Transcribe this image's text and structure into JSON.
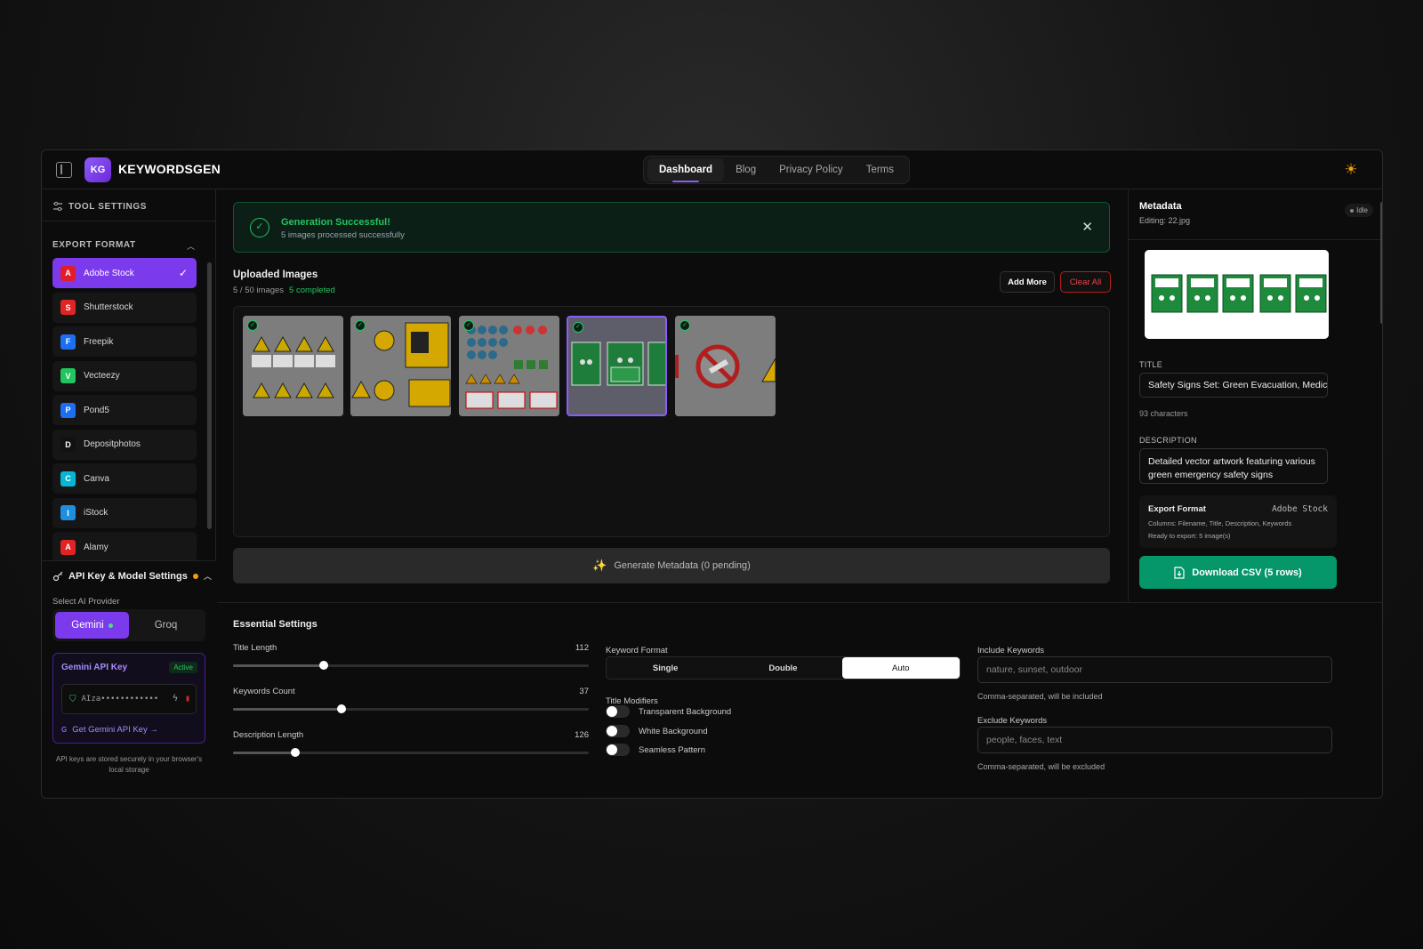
{
  "app": {
    "logo_badge": "KG",
    "name": "KEYWORDSGEN"
  },
  "nav": [
    {
      "label": "Dashboard",
      "active": true
    },
    {
      "label": "Blog"
    },
    {
      "label": "Privacy Policy"
    },
    {
      "label": "Terms"
    }
  ],
  "sidebar": {
    "tool_settings": "TOOL SETTINGS",
    "export_format": "EXPORT FORMAT",
    "platforms": [
      {
        "letter": "A",
        "label": "Adobe Stock",
        "color": "#e11d2d",
        "selected": true
      },
      {
        "letter": "S",
        "label": "Shutterstock",
        "color": "#e02424"
      },
      {
        "letter": "F",
        "label": "Freepik",
        "color": "#1d6ff2"
      },
      {
        "letter": "V",
        "label": "Vecteezy",
        "color": "#22c55e"
      },
      {
        "letter": "P",
        "label": "Pond5",
        "color": "#1d6ff2"
      },
      {
        "letter": "D",
        "label": "Depositphotos",
        "color": "#111111"
      },
      {
        "letter": "C",
        "label": "Canva",
        "color": "#06b6d4"
      },
      {
        "letter": "I",
        "label": "iStock",
        "color": "#1d8fe0"
      },
      {
        "letter": "A",
        "label": "Alamy",
        "color": "#e02424"
      }
    ],
    "api_title": "API Key & Model Settings",
    "provider_label": "Select AI Provider",
    "providers": [
      "Gemini",
      "Groq"
    ],
    "key_title": "Gemini API Key",
    "key_status": "Active",
    "key_value": "AIza••••••••••••",
    "get_key": "Get Gemini API Key →",
    "get_key_badge": "G",
    "storage_note": "API keys are stored securely in your browser's local storage"
  },
  "alert": {
    "title": "Generation Successful!",
    "message": "5 images processed successfully"
  },
  "uploads": {
    "title": "Uploaded Images",
    "count": "5 / 50 images",
    "completed": "5 completed",
    "add_more": "Add More",
    "clear_all": "Clear All",
    "generate": "Generate Metadata (0 pending)"
  },
  "metadata": {
    "title": "Metadata",
    "editing": "Editing: 22.jpg",
    "status": "Idle",
    "title_label": "TITLE",
    "title_value": "Safety Signs Set: Green Evacuation, Medical",
    "title_chars": "93 characters",
    "desc_label": "DESCRIPTION",
    "desc_value": "Detailed vector artwork featuring various green emergency safety signs",
    "export_label": "Export Format",
    "export_value": "Adobe Stock",
    "columns": "Columns: Filename, Title, Description, Keywords",
    "ready": "Ready to export: 5 image(s)",
    "download": "Download CSV (5 rows)"
  },
  "settings": {
    "title": "Essential Settings",
    "sliders": [
      {
        "label": "Title Length",
        "value": "112",
        "fraction": 0.25
      },
      {
        "label": "Keywords Count",
        "value": "37",
        "fraction": 0.3
      },
      {
        "label": "Description Length",
        "value": "126",
        "fraction": 0.17
      }
    ],
    "keyword_format_label": "Keyword Format",
    "keyword_formats": [
      "Single",
      "Double",
      "Auto"
    ],
    "keyword_format_selected": "Auto",
    "title_modifiers_label": "Title Modifiers",
    "modifiers": [
      "Transparent Background",
      "White Background",
      "Seamless Pattern"
    ],
    "include_label": "Include Keywords",
    "include_placeholder": "nature, sunset, outdoor",
    "include_hint": "Comma-separated, will be included",
    "exclude_label": "Exclude Keywords",
    "exclude_placeholder": "people, faces, text",
    "exclude_hint": "Comma-separated, will be excluded"
  }
}
